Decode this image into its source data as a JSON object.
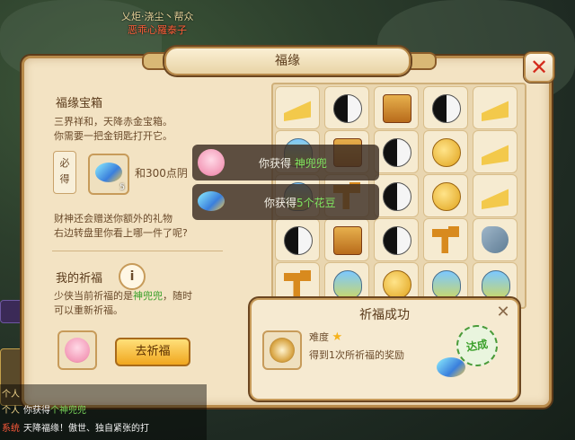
{
  "background": {
    "top_lines": [
      "乂炬·浇尘丶帮众",
      "恶乖心羅泰子"
    ]
  },
  "panel": {
    "title": "福缘",
    "close": "✕"
  },
  "left": {
    "section_title": "福缘宝箱",
    "desc_lines": [
      "三界祥和，天降赤金宝箱。",
      "你需要一把金钥匙打开它。"
    ],
    "must_label": "必得",
    "item_count": "5",
    "reward_text": "和300点阴",
    "more_lines": [
      "财神还会赠送你额外的礼物",
      "右边转盘里你看上哪一件了呢?"
    ],
    "prayer_title": "我的祈福",
    "info_icon": "i",
    "prayer_line1_prefix": "少侠当前祈福的是",
    "prayer_line1_name": "神兜兜",
    "prayer_line1_suffix": "，随时",
    "prayer_line2": "可以重新祈福。",
    "go_button": "去祈福"
  },
  "grid": {
    "rows": [
      [
        "cheese",
        "yinyang",
        "scroll",
        "yinyang",
        "cheese"
      ],
      [
        "bag",
        "scroll",
        "yinyang",
        "gold",
        "cheese"
      ],
      [
        "bag",
        "hammer",
        "yinyang",
        "gold",
        "cheese"
      ],
      [
        "yinyang",
        "scroll",
        "yinyang",
        "hammer",
        "key"
      ],
      [
        "hammer",
        "bag",
        "gold",
        "bag",
        "bag"
      ]
    ]
  },
  "toasts": {
    "t1_prefix": "你获得",
    "t1_item": "神兜兜",
    "t2_prefix": "你获得",
    "t2_item": "5个花豆"
  },
  "blessing": {
    "title": "祈福成功",
    "difficulty_label": "难度",
    "reward_text": "得到1次所祈福的奖励",
    "stamp": "达成"
  },
  "chat": {
    "lines": [
      {
        "tag": "个人",
        "text": "",
        "tag_color": "normal"
      },
      {
        "tag": "个人",
        "text": "你获得",
        "green": "个神兜兜"
      },
      {
        "tag": "系统",
        "text": "天降福缘！傲世、独自紧张的打",
        "tag_color": "red"
      }
    ]
  },
  "icons": {
    "close": "close-icon",
    "info": "info-icon",
    "star": "star-icon"
  },
  "colors": {
    "accent_green": "#3aa02a",
    "close_red": "#d42b1c",
    "button_gold": "#f0a61e"
  }
}
